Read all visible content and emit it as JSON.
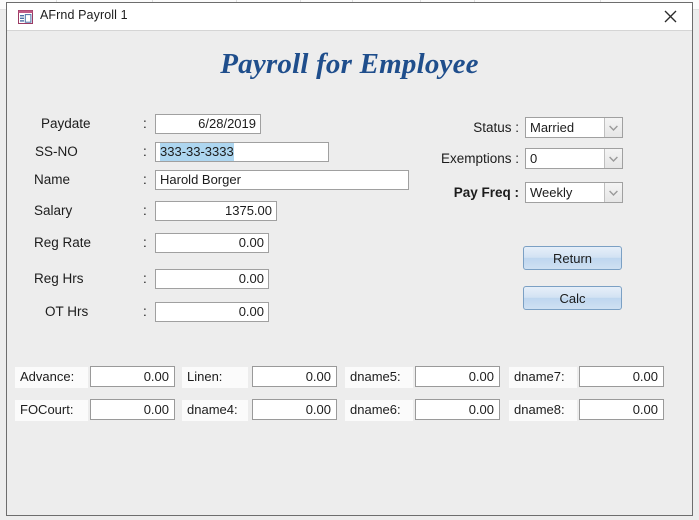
{
  "window": {
    "title": "AFrnd Payroll 1",
    "icon": "access-form-icon",
    "close_label": "✕"
  },
  "form": {
    "heading": "Payroll for Employee",
    "heading_color": "#1f4e8c",
    "separator": ":",
    "fields": [
      {
        "label": "Paydate",
        "value": "6/28/2019",
        "align": "num",
        "selected": false
      },
      {
        "label": "SS-NO",
        "value": "333-33-3333",
        "align": "txt",
        "selected": true
      },
      {
        "label": "Name",
        "value": "Harold Borger",
        "align": "txt",
        "selected": false
      },
      {
        "label": "Salary",
        "value": "1375.00",
        "align": "num",
        "selected": false
      },
      {
        "label": "Reg Rate",
        "value": "0.00",
        "align": "num",
        "selected": false
      },
      {
        "label": "Reg Hrs",
        "value": "0.00",
        "align": "num",
        "selected": false
      },
      {
        "label": "OT Hrs",
        "value": "0.00",
        "align": "num",
        "selected": false
      }
    ],
    "combos": [
      {
        "label": "Status :",
        "value": "Married",
        "bold": false
      },
      {
        "label": "Exemptions :",
        "value": "0",
        "bold": false
      },
      {
        "label": "Pay Freq   :",
        "value": "Weekly",
        "bold": true
      }
    ],
    "buttons": {
      "return_label": "Return",
      "calc_label": "Calc"
    },
    "deductions": [
      {
        "label": "Advance:",
        "value": "0.00"
      },
      {
        "label": "Linen:",
        "value": "0.00"
      },
      {
        "label": "dname5:",
        "value": "0.00"
      },
      {
        "label": "dname7:",
        "value": "0.00"
      },
      {
        "label": "FOCourt:",
        "value": "0.00"
      },
      {
        "label": "dname4:",
        "value": "0.00"
      },
      {
        "label": "dname6:",
        "value": "0.00"
      },
      {
        "label": "dname8:",
        "value": "0.00"
      }
    ]
  },
  "selection_color": "#add6f0"
}
